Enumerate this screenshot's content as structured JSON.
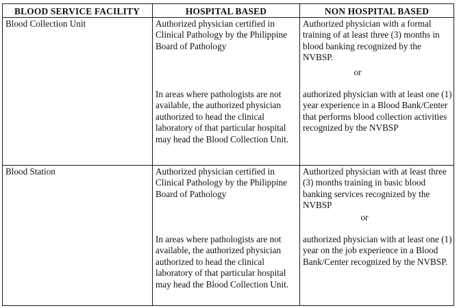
{
  "headers": {
    "facility": "BLOOD SERVICE FACILITY",
    "hospital": "HOSPITAL BASED",
    "non_hospital": "NON HOSPITAL BASED"
  },
  "rows": [
    {
      "facility": "Blood Collection Unit",
      "hospital_1": "Authorized physician certified in Clinical Pathology by the Philippine Board of Pathology",
      "hospital_2": "In areas where pathologists are not available, the authorized physician authorized to head the clinical laboratory of that particular hospital may head the Blood Collection Unit.",
      "non_hospital_1": "Authorized physician with a formal training of at least three (3) months in blood banking recognized by the NVBSP.",
      "or": "or",
      "non_hospital_2": "authorized physician with  at least one (1) year experience in a Blood Bank/Center that performs blood collection activities recognized by the NVBSP"
    },
    {
      "facility": "Blood Station",
      "hospital_1": "Authorized physician certified in Clinical Pathology by the Philippine Board of Pathology",
      "hospital_2": "In areas where pathologists are not available, the authorized physician authorized to head the clinical laboratory of that particular hospital may head the Blood Collection Unit.",
      "non_hospital_1": "Authorized physician with at least three (3) months training in basic blood banking services recognized by the NVBSP",
      "or": "or",
      "non_hospital_2": "authorized physician with at least one (1) year on the job experience in a  Blood Bank/Center recognized by the NVBSP."
    }
  ]
}
